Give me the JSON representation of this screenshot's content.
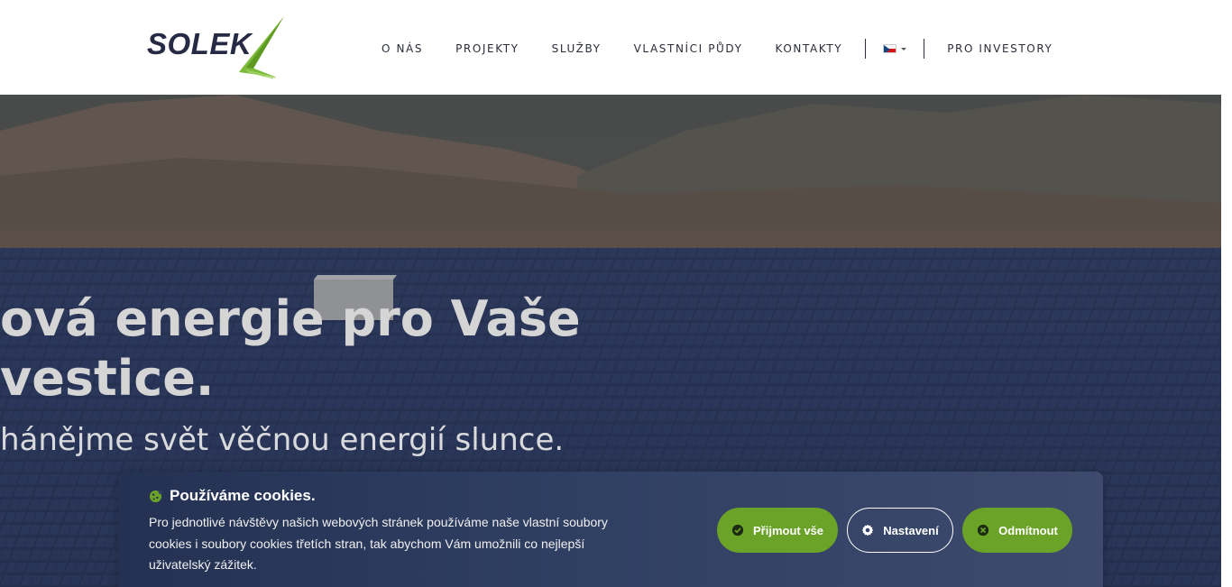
{
  "brand": {
    "logo_text": "SOLEK"
  },
  "nav": {
    "items": [
      "O NÁS",
      "PROJEKTY",
      "SLUŽBY",
      "VLASTNÍCI PŮDY",
      "KONTAKTY"
    ],
    "language_icon": "czech-flag-icon",
    "investors": "PRO INVESTORY"
  },
  "hero": {
    "title_line1": "ová energie pro Vaše",
    "title_line2": "vestice.",
    "subtitle": "hánějme svět věčnou energií slunce."
  },
  "cookie": {
    "title": "Používáme cookies.",
    "text": "Pro jednotlivé návštěvy našich webových stránek používáme naše vlastní soubory cookies i soubory cookies třetích stran, tak abychom Vám umožnili co nejlepší uživatelský zážitek.",
    "accept": "Přijmout vše",
    "settings": "Nastavení",
    "reject": "Odmítnout"
  },
  "colors": {
    "accent_green": "#6aa328",
    "logo_navy": "#262a44",
    "cookie_bg": "#2f3f62"
  }
}
